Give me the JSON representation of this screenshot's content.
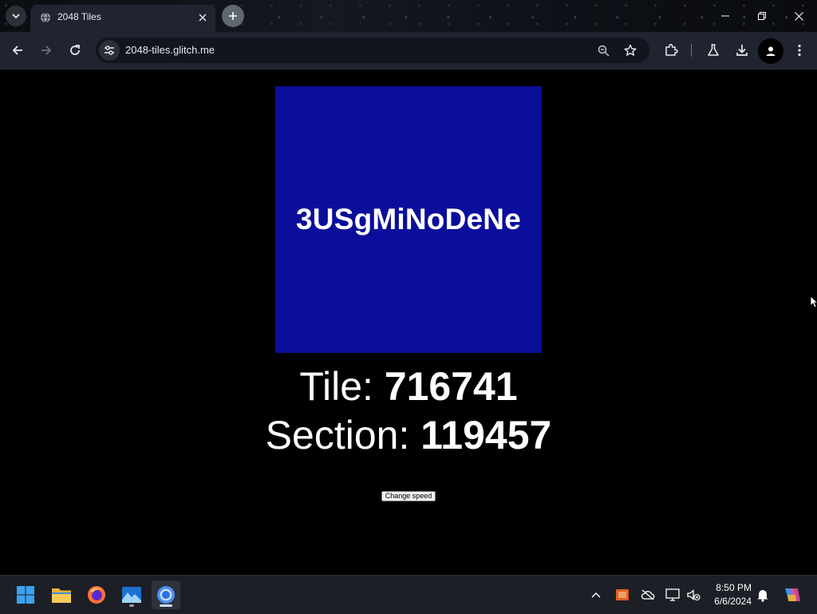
{
  "browser": {
    "tab_title": "2048 Tiles",
    "url": "2048-tiles.glitch.me"
  },
  "page": {
    "tile_label": "3USgMiNoDeNe",
    "tile_color": "#0b0e9a",
    "tile_stat_label": "Tile: ",
    "tile_stat_value": "716741",
    "section_stat_label": "Section: ",
    "section_stat_value": "119457",
    "change_speed_label": "Change speed"
  },
  "taskbar": {
    "time": "8:50 PM",
    "date": "6/6/2024"
  },
  "icons": {
    "tab_search": "chevron-down-icon",
    "favicon": "globe-icon",
    "back": "arrow-left-icon",
    "forward": "arrow-right-icon",
    "reload": "reload-icon",
    "extensions": "puzzle-icon",
    "labs": "flask-icon",
    "downloads": "download-icon",
    "menu": "kebab-menu-icon"
  }
}
